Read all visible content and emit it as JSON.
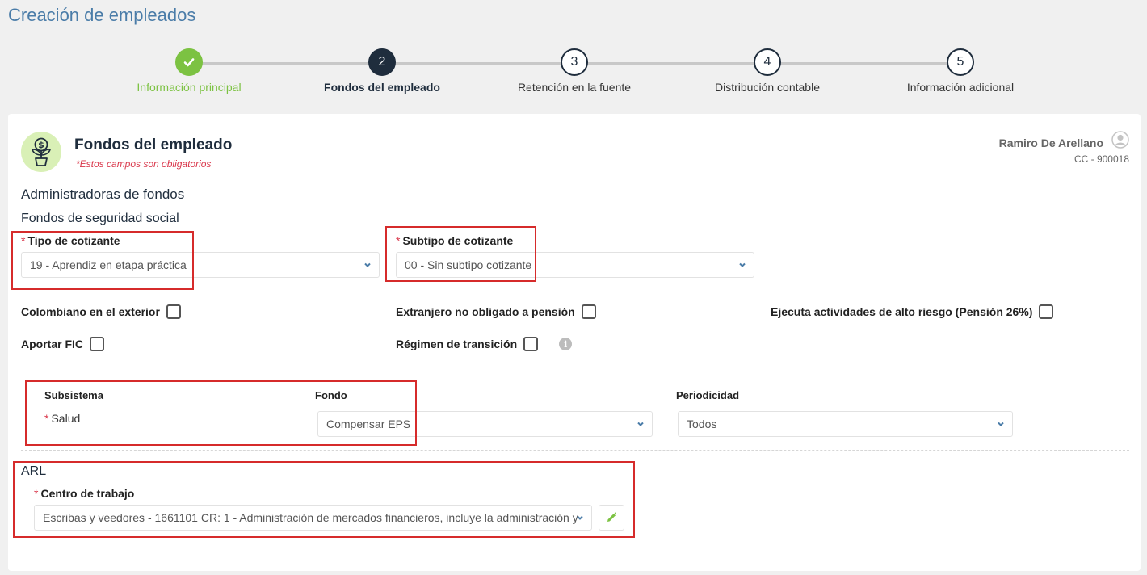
{
  "page": {
    "title": "Creación de empleados"
  },
  "stepper": {
    "steps": [
      {
        "label": "Información principal",
        "number": "1",
        "state": "done"
      },
      {
        "label": "Fondos del empleado",
        "number": "2",
        "state": "active"
      },
      {
        "label": "Retención en la fuente",
        "number": "3",
        "state": "pending"
      },
      {
        "label": "Distribución contable",
        "number": "4",
        "state": "pending"
      },
      {
        "label": "Información adicional",
        "number": "5",
        "state": "pending"
      }
    ]
  },
  "card": {
    "title": "Fondos del empleado",
    "required_note": "*Estos campos son obligatorios",
    "user": {
      "name": "Ramiro De Arellano",
      "doc": "CC - 900018"
    }
  },
  "administradoras": {
    "heading": "Administradoras de fondos",
    "subheading": "Fondos de seguridad social",
    "tipo_cotizante": {
      "label": "Tipo de cotizante",
      "value": "19 - Aprendiz en etapa práctica"
    },
    "subtipo_cotizante": {
      "label": "Subtipo de cotizante",
      "value": "00 - Sin subtipo cotizante"
    },
    "checks": {
      "colombiano_exterior": "Colombiano en el exterior",
      "extranjero_pension": "Extranjero no obligado a pensión",
      "alto_riesgo": "Ejecuta actividades de alto riesgo (Pensión 26%)",
      "aportar_fic": "Aportar FIC",
      "regimen_transicion": "Régimen de transición",
      "info_glyph": "i"
    }
  },
  "subsistemas": {
    "headers": {
      "subsistema": "Subsistema",
      "fondo": "Fondo",
      "periodicidad": "Periodicidad"
    },
    "rows": [
      {
        "subsistema": "Salud",
        "fondo": "Compensar EPS",
        "periodicidad": "Todos"
      }
    ]
  },
  "arl": {
    "heading": "ARL",
    "centro_label": "Centro de trabajo",
    "centro_value": "Escribas y veedores - 1661101 CR: 1 - Administración de mercados financieros, incluye la administración y"
  },
  "colors": {
    "accent": "#4a7ca8",
    "done": "#7cc242",
    "active": "#1f2d3d",
    "required": "#d9364a",
    "highlight": "#d62b2b"
  },
  "icons": {
    "step_done": "check-icon",
    "emblem": "money-plant-icon",
    "avatar": "user-avatar-icon",
    "dropdown": "chevron-down-icon",
    "info": "info-icon",
    "edit": "pencil-icon"
  }
}
